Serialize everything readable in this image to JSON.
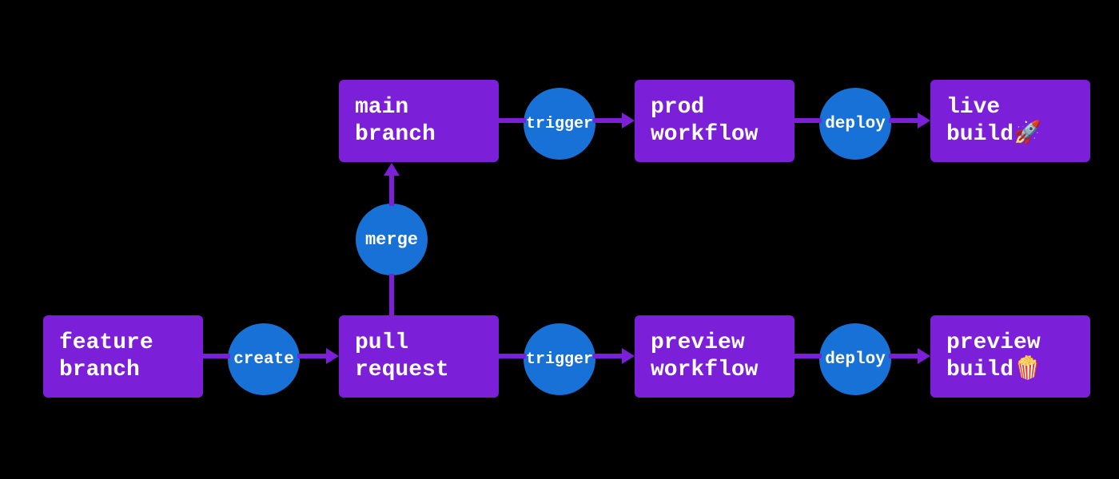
{
  "boxes": {
    "feature_branch": "feature\nbranch",
    "pull_request": "pull\nrequest",
    "main_branch": "main\nbranch",
    "prod_workflow": "prod\nworkflow",
    "live_build": "live\nbuild🚀",
    "preview_workflow": "preview\nworkflow",
    "preview_build": "preview\nbuild🍿"
  },
  "actions": {
    "create": "create",
    "merge": "merge",
    "trigger_top": "trigger",
    "deploy_top": "deploy",
    "trigger_bottom": "trigger",
    "deploy_bottom": "deploy"
  },
  "colors": {
    "box_bg": "#7c1fd9",
    "circle_bg": "#1771d7",
    "text": "#ffffff",
    "bg": "#000000"
  }
}
